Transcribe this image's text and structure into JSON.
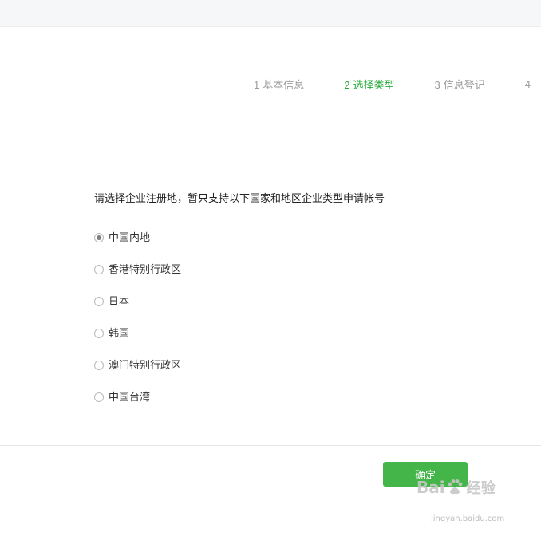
{
  "steps": [
    {
      "num": "1",
      "label": "基本信息",
      "state": "done"
    },
    {
      "num": "2",
      "label": "选择类型",
      "state": "active"
    },
    {
      "num": "3",
      "label": "信息登记",
      "state": "pending"
    },
    {
      "num": "4",
      "label": "",
      "state": "pending"
    }
  ],
  "instruction": "请选择企业注册地，暂只支持以下国家和地区企业类型申请帐号",
  "options": [
    {
      "label": "中国内地",
      "checked": true
    },
    {
      "label": "香港特别行政区",
      "checked": false
    },
    {
      "label": "日本",
      "checked": false
    },
    {
      "label": "韩国",
      "checked": false
    },
    {
      "label": "澳门特别行政区",
      "checked": false
    },
    {
      "label": "中国台湾",
      "checked": false
    }
  ],
  "confirm_label": "确定",
  "watermark": {
    "prefix": "Bai",
    "suffix": "经验",
    "url": "jingyan.baidu.com"
  },
  "colors": {
    "accent": "#44b549",
    "active_step": "#22aa38",
    "muted": "#9a9a9a"
  }
}
